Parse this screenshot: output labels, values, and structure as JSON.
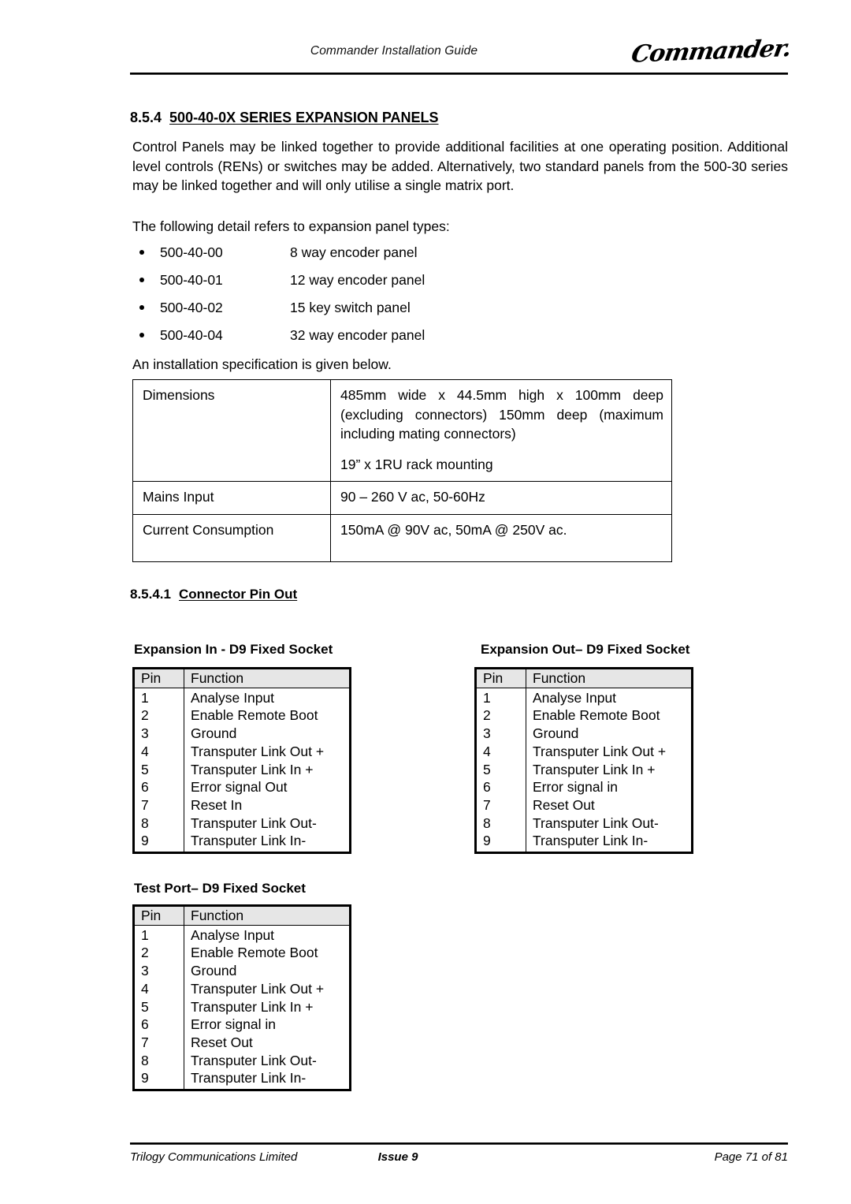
{
  "header": {
    "title": "Commander Installation Guide",
    "logo": "Commander."
  },
  "heading_854": {
    "number": "8.5.4",
    "title": "500-40-0X SERIES EXPANSION PANELS"
  },
  "paragraphs": {
    "intro": "Control Panels may be linked together to provide additional facilities at one operating position. Additional level controls (RENs) or switches may be added. Alternatively, two standard panels from the 500-30 series may be linked together and will only utilise a single matrix port.",
    "following": "The following detail refers to expansion panel types:",
    "spec_note": "An installation specification is given below."
  },
  "panel_types": [
    {
      "code": "500-40-00",
      "description": "8 way encoder panel"
    },
    {
      "code": "500-40-01",
      "description": "12 way encoder panel"
    },
    {
      "code": "500-40-02",
      "description": "15 key switch panel"
    },
    {
      "code": "500-40-04",
      "description": "32 way encoder panel"
    }
  ],
  "spec_table": {
    "rows": [
      {
        "label": "Dimensions",
        "value_1": "485mm wide x 44.5mm high x 100mm deep (excluding connectors) 150mm deep (maximum including mating connectors)",
        "value_2": "19” x 1RU rack mounting"
      },
      {
        "label": "Mains Input",
        "value_1": "90 – 260 V ac, 50-60Hz"
      },
      {
        "label": "Current Consumption",
        "value_1": "150mA @ 90V ac, 50mA @ 250V ac."
      }
    ]
  },
  "heading_8541": {
    "number": "8.5.4.1",
    "title": "Connector Pin Out"
  },
  "pin_tables": [
    {
      "id": "expansion-in",
      "caption": "Expansion In - D9 Fixed Socket",
      "columns": {
        "pin": "Pin",
        "function": "Function"
      },
      "rows": [
        {
          "pin": "1",
          "function": "Analyse Input"
        },
        {
          "pin": "2",
          "function": "Enable Remote Boot"
        },
        {
          "pin": "3",
          "function": "Ground"
        },
        {
          "pin": "4",
          "function": "Transputer Link Out +"
        },
        {
          "pin": "5",
          "function": "Transputer Link In +"
        },
        {
          "pin": "6",
          "function": "Error signal Out"
        },
        {
          "pin": "7",
          "function": "Reset In"
        },
        {
          "pin": "8",
          "function": "Transputer Link Out-"
        },
        {
          "pin": "9",
          "function": "Transputer Link In-"
        }
      ]
    },
    {
      "id": "expansion-out",
      "caption": "Expansion Out– D9 Fixed Socket",
      "columns": {
        "pin": "Pin",
        "function": "Function"
      },
      "rows": [
        {
          "pin": "1",
          "function": "Analyse Input"
        },
        {
          "pin": "2",
          "function": "Enable Remote Boot"
        },
        {
          "pin": "3",
          "function": "Ground"
        },
        {
          "pin": "4",
          "function": "Transputer Link Out +"
        },
        {
          "pin": "5",
          "function": "Transputer Link In +"
        },
        {
          "pin": "6",
          "function": "Error signal in"
        },
        {
          "pin": "7",
          "function": "Reset Out"
        },
        {
          "pin": "8",
          "function": "Transputer Link Out-"
        },
        {
          "pin": "9",
          "function": "Transputer Link In-"
        }
      ]
    },
    {
      "id": "test-port",
      "caption": "Test Port– D9 Fixed Socket",
      "columns": {
        "pin": "Pin",
        "function": "Function"
      },
      "rows": [
        {
          "pin": "1",
          "function": "Analyse Input"
        },
        {
          "pin": "2",
          "function": "Enable Remote Boot"
        },
        {
          "pin": "3",
          "function": "Ground"
        },
        {
          "pin": "4",
          "function": "Transputer Link Out +"
        },
        {
          "pin": "5",
          "function": "Transputer Link In +"
        },
        {
          "pin": "6",
          "function": "Error signal in"
        },
        {
          "pin": "7",
          "function": "Reset Out"
        },
        {
          "pin": "8",
          "function": "Transputer Link Out-"
        },
        {
          "pin": "9",
          "function": "Transputer Link In-"
        }
      ]
    }
  ],
  "footer": {
    "company": "Trilogy Communications Limited",
    "issue": "Issue 9",
    "page": "Page 71 of 81"
  }
}
